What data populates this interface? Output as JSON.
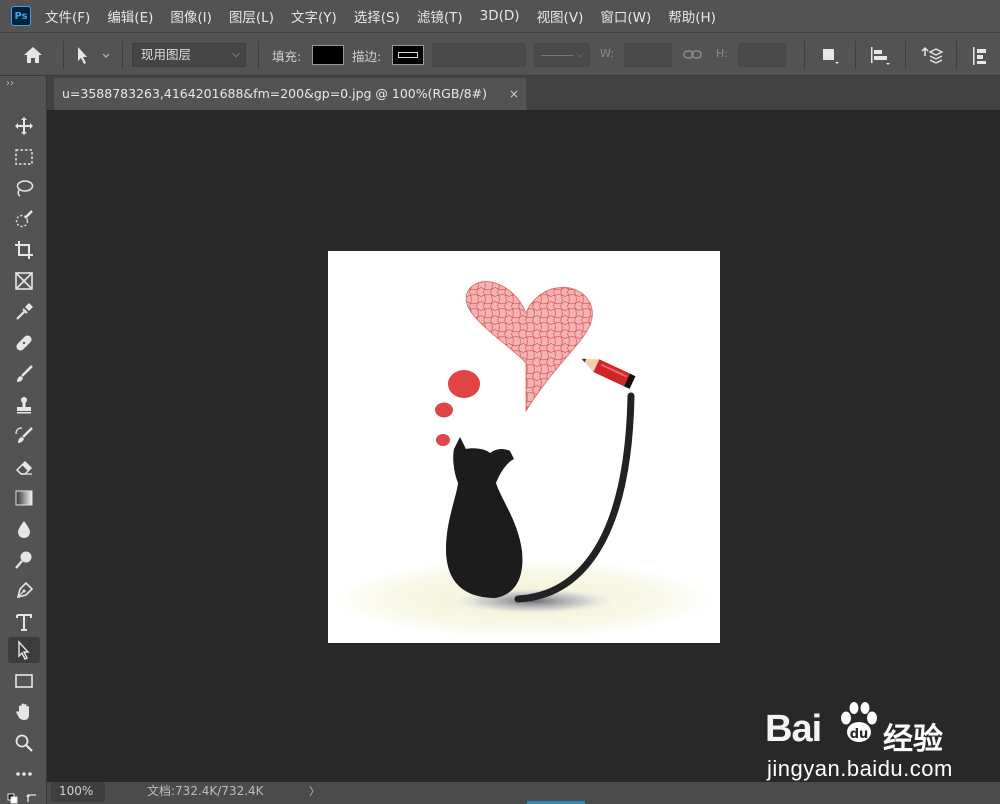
{
  "app": {
    "logo": "Ps"
  },
  "menu": [
    "文件(F)",
    "编辑(E)",
    "图像(I)",
    "图层(L)",
    "文字(Y)",
    "选择(S)",
    "滤镜(T)",
    "3D(D)",
    "视图(V)",
    "窗口(W)",
    "帮助(H)"
  ],
  "options": {
    "layer_mode": "现用图层",
    "fill_label": "填充:",
    "stroke_label": "描边:",
    "w_label": "W:",
    "h_label": "H:",
    "fill_color": "#000000"
  },
  "document": {
    "tab_title": "u=3588783263,4164201688&fm=200&gp=0.jpg @ 100%(RGB/8#)",
    "close": "×"
  },
  "status": {
    "zoom": "100%",
    "doc_info": "文档:732.4K/732.4K",
    "arrow": "〉"
  },
  "toolbar": {
    "collapse": "››",
    "tools": [
      "move-tool",
      "marquee-tool",
      "lasso-tool",
      "quick-selection-tool",
      "crop-tool",
      "frame-tool",
      "eyedropper-tool",
      "healing-brush-tool",
      "brush-tool",
      "clone-stamp-tool",
      "history-brush-tool",
      "eraser-tool",
      "gradient-tool",
      "blur-tool",
      "dodge-tool",
      "pen-tool",
      "type-tool",
      "path-selection-tool",
      "rectangle-tool",
      "hand-tool",
      "zoom-tool",
      "more-tools"
    ],
    "active_tool": "path-selection-tool"
  },
  "watermark": {
    "brand_left": "Bai",
    "brand_right": "经验",
    "url": "jingyan.baidu.com"
  },
  "colors": {
    "ui_panel": "#535353",
    "canvas_bg": "#282828",
    "heart": "#e03c3c"
  }
}
